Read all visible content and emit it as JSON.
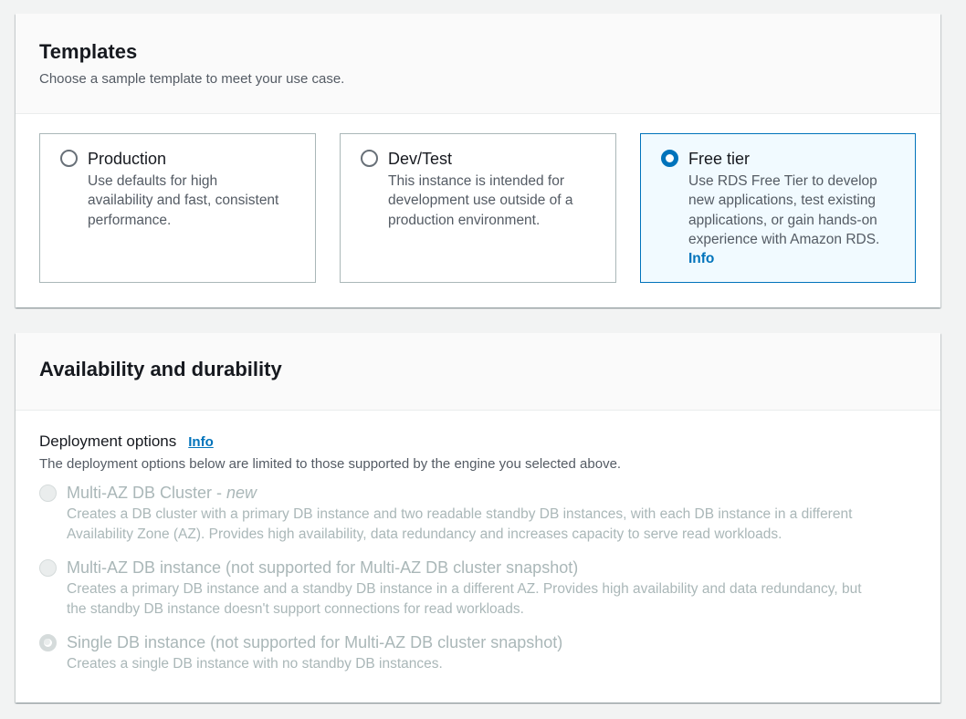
{
  "templates": {
    "title": "Templates",
    "description": "Choose a sample template to meet your use case.",
    "options": [
      {
        "title": "Production",
        "description_lines": [
          "Use defaults for high",
          "availability and fast, consistent",
          "performance."
        ],
        "selected": false
      },
      {
        "title": "Dev/Test",
        "description_lines": [
          "This instance is intended for",
          "development use outside of a",
          "production environment."
        ],
        "selected": false
      },
      {
        "title": "Free tier",
        "description_lines": [
          "Use RDS Free Tier to develop",
          "new applications, test existing",
          "applications, or gain hands-on",
          "experience with Amazon RDS."
        ],
        "info_link": "Info",
        "selected": true
      }
    ]
  },
  "availability": {
    "title": "Availability and durability",
    "deployment": {
      "label": "Deployment options",
      "info_link": "Info",
      "description": "The deployment options below are limited to those supported by the engine you selected above.",
      "options": [
        {
          "title": "Multi-AZ DB Cluster - ",
          "title_suffix": "new",
          "description_lines": [
            "Creates a DB cluster with a primary DB instance and two readable standby DB instances, with each DB instance in a different",
            "Availability Zone (AZ). Provides high availability, data redundancy and increases capacity to serve read workloads."
          ],
          "checked": false,
          "disabled": true
        },
        {
          "title": "Multi-AZ DB instance (not supported for Multi-AZ DB cluster snapshot)",
          "description_lines": [
            "Creates a primary DB instance and a standby DB instance in a different AZ. Provides high availability and data redundancy, but",
            "the standby DB instance doesn't support connections for read workloads."
          ],
          "checked": false,
          "disabled": true
        },
        {
          "title": "Single DB instance (not supported for Multi-AZ DB cluster snapshot)",
          "description_lines": [
            "Creates a single DB instance with no standby DB instances."
          ],
          "checked": true,
          "disabled": true
        }
      ]
    }
  },
  "colors": {
    "accent": "#0073bb",
    "selected_tile_bg": "#f1faff",
    "disabled_text": "#aab7b8"
  }
}
